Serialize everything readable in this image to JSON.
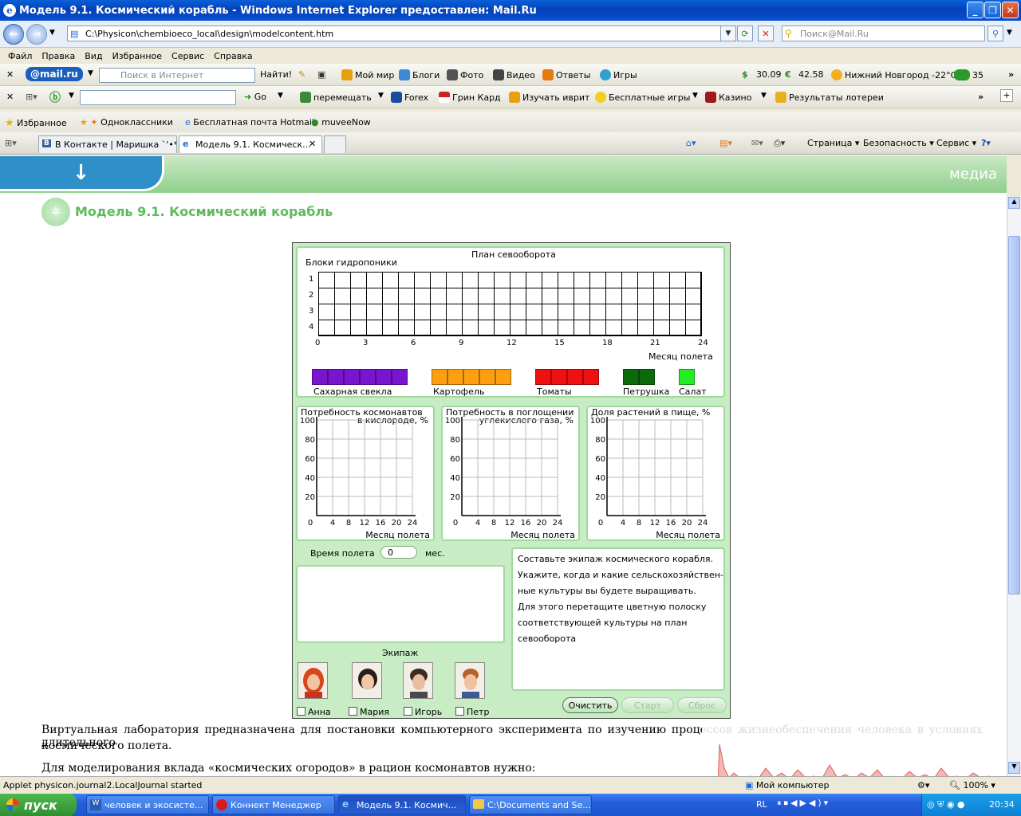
{
  "window": {
    "title": "Модель 9.1. Космический корабль - Windows Internet Explorer предоставлен: Mail.Ru"
  },
  "address": {
    "url": "C:\\Physicon\\chembioeco_local\\design\\modelcontent.htm",
    "search_placeholder": "Поиск@Mail.Ru"
  },
  "menu": [
    "Файл",
    "Правка",
    "Вид",
    "Избранное",
    "Сервис",
    "Справка"
  ],
  "mailru_toolbar": {
    "logo": "@mail.ru",
    "search_placeholder": "Поиск в Интернет",
    "find_label": "Найти!",
    "my_world": "Мой мир",
    "blogs": "Блоги",
    "photo": "Фото",
    "video": "Видео",
    "answers": "Ответы",
    "games": "Игры",
    "usd": "30.09",
    "eur": "42.58",
    "weather": "Нижний Новгород -22°C",
    "traffic": "35"
  },
  "second_toolbar": {
    "go_label": "Go",
    "move": "перемещать",
    "forex": "Forex",
    "green_card": "Грин Кард",
    "hebrew": "Изучать иврит",
    "free_games": "Бесплатные игры",
    "casino": "Казино",
    "lottery": "Результаты лотереи"
  },
  "favorites": {
    "label": "Избранное",
    "items": [
      "Одноклассники",
      "Бесплатная почта Hotmail",
      "muveeNow"
    ]
  },
  "tabs": [
    {
      "label": "В Контакте | Маришка `'•*..."
    },
    {
      "label": "Модель 9.1. Космическ..."
    }
  ],
  "cmdbar": {
    "page": "Страница",
    "security": "Безопасность",
    "service": "Сервис"
  },
  "banner": {
    "media": "медиа"
  },
  "model_title": "Модель 9.1.  Космический корабль",
  "applet": {
    "plan_title": "План севооборота",
    "blocks_label": "Блоки гидропоники",
    "rows": [
      "1",
      "2",
      "3",
      "4"
    ],
    "x_ticks": [
      "0",
      "3",
      "6",
      "9",
      "12",
      "15",
      "18",
      "21",
      "24"
    ],
    "month_label": "Месяц полета",
    "crops": [
      {
        "name": "Сахарная свекла",
        "color": "#7a14cf",
        "segments": 6
      },
      {
        "name": "Картофель",
        "color": "#ff9e10",
        "segments": 5
      },
      {
        "name": "Томаты",
        "color": "#f01010",
        "segments": 4
      },
      {
        "name": "Петрушка",
        "color": "#0b6a0b",
        "segments": 2
      },
      {
        "name": "Салат",
        "color": "#22ee22",
        "segments": 1
      }
    ],
    "charts": [
      {
        "title1": "Потребность космонавтов",
        "title2": "в кислороде, %"
      },
      {
        "title1": "Потребность в поглощении",
        "title2": "углекислого газа, %"
      },
      {
        "title1": "Доля растений в пище, %",
        "title2": ""
      }
    ],
    "chart_y_ticks": [
      "100",
      "80",
      "60",
      "40",
      "20",
      "0"
    ],
    "chart_x_ticks": [
      "4",
      "8",
      "12",
      "16",
      "20",
      "24"
    ],
    "flight_time_label": "Время полета",
    "flight_time_value": "0",
    "flight_time_unit": "мес.",
    "instructions": [
      "Составьте экипаж космического корабля.",
      "Укажите, когда и какие сельскохозяйствен-",
      "ные культуры вы будете выращивать.",
      "Для этого перетащите цветную полоску",
      "соответствующей культуры на план",
      "севооборота"
    ],
    "crew_label": "Экипаж",
    "crew": [
      "Анна",
      "Мария",
      "Игорь",
      "Петр"
    ],
    "btn_clear": "Очистить",
    "btn_start": "Старт",
    "btn_reset": "Сброс"
  },
  "page_text": {
    "p1a": "Виртуальная лаборатория предназначена для постановки компьютерного эксперимента по изучению процессов жизнеобеспечения человека в условиях длительного",
    "p1b": "космического полета.",
    "p2": "Для моделирования вклада «космических огородов» в рацион космонавтов нужно:"
  },
  "status": {
    "text": "Applet physicon.journal2.LocalJournal started",
    "zone": "Мой компьютер",
    "zoom": "100%"
  },
  "taskbar": {
    "start": "пуск",
    "items": [
      {
        "label": "человек и экосисте..."
      },
      {
        "label": "Коннект Менеджер"
      },
      {
        "label": "Модель 9.1. Космич..."
      },
      {
        "label": "C:\\Documents and Se..."
      }
    ],
    "lang": "RL",
    "clock": "20:34"
  }
}
